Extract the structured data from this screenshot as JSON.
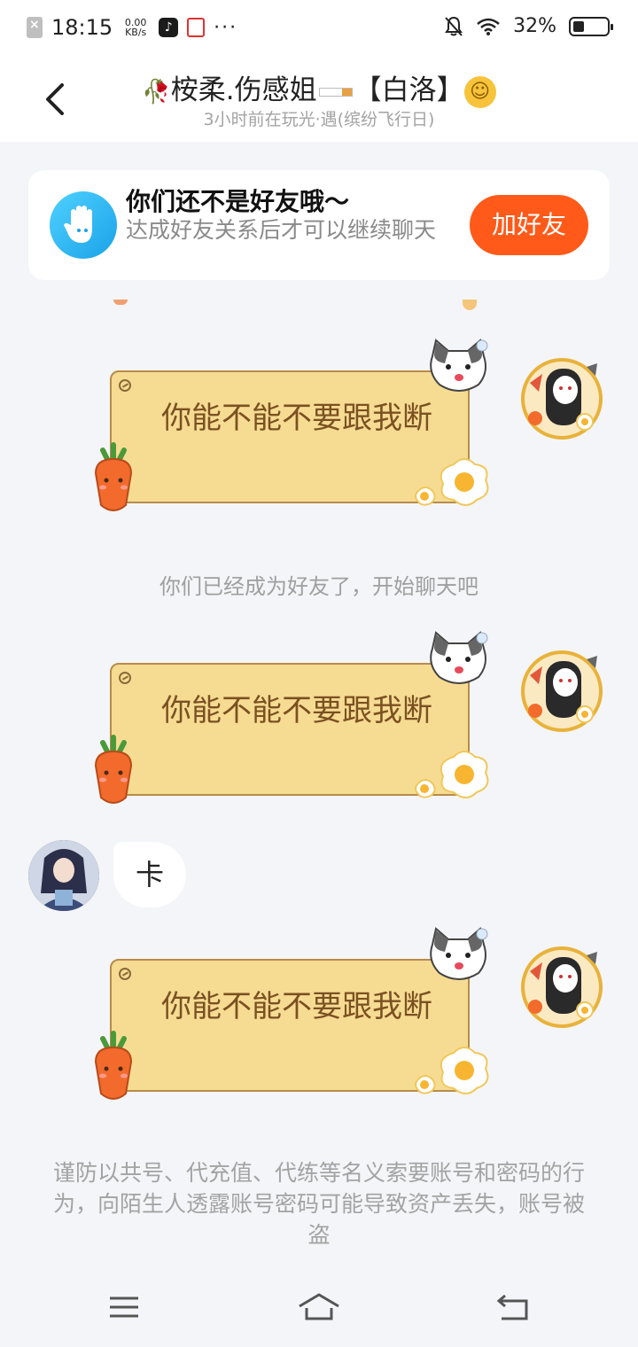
{
  "status_bar": {
    "time": "18:15",
    "net_speed_value": "0.00",
    "net_speed_unit": "KB/s",
    "more": "···",
    "battery_text": "32%",
    "battery_level": 0.32
  },
  "header": {
    "title_name": "桉柔.伤感姐",
    "title_tag": "【白洛】",
    "subtitle": "3小时前在玩光·遇(缤纷飞行日)"
  },
  "friend_card": {
    "title": "你们还不是好友哦～",
    "description": "达成好友关系后才可以继续聊天",
    "button_label": "加好友"
  },
  "messages": [
    {
      "side": "right",
      "text": "你能不能不要跟我断"
    },
    {
      "side": "right",
      "text": "你能不能不要跟我断"
    },
    {
      "side": "left",
      "text": "卡"
    },
    {
      "side": "right",
      "text": "你能不能不要跟我断"
    }
  ],
  "system_notice": "你们已经成为好友了，开始聊天吧",
  "warning": "谨防以共号、代充值、代练等名义索要账号和密码的行为，向陌生人透露账号密码可能导致资产丢失，账号被盗",
  "colors": {
    "accent": "#ff5a1a",
    "bubble_fill": "#f6dc92",
    "bubble_text": "#7b5022",
    "background": "#f4f5f8"
  }
}
